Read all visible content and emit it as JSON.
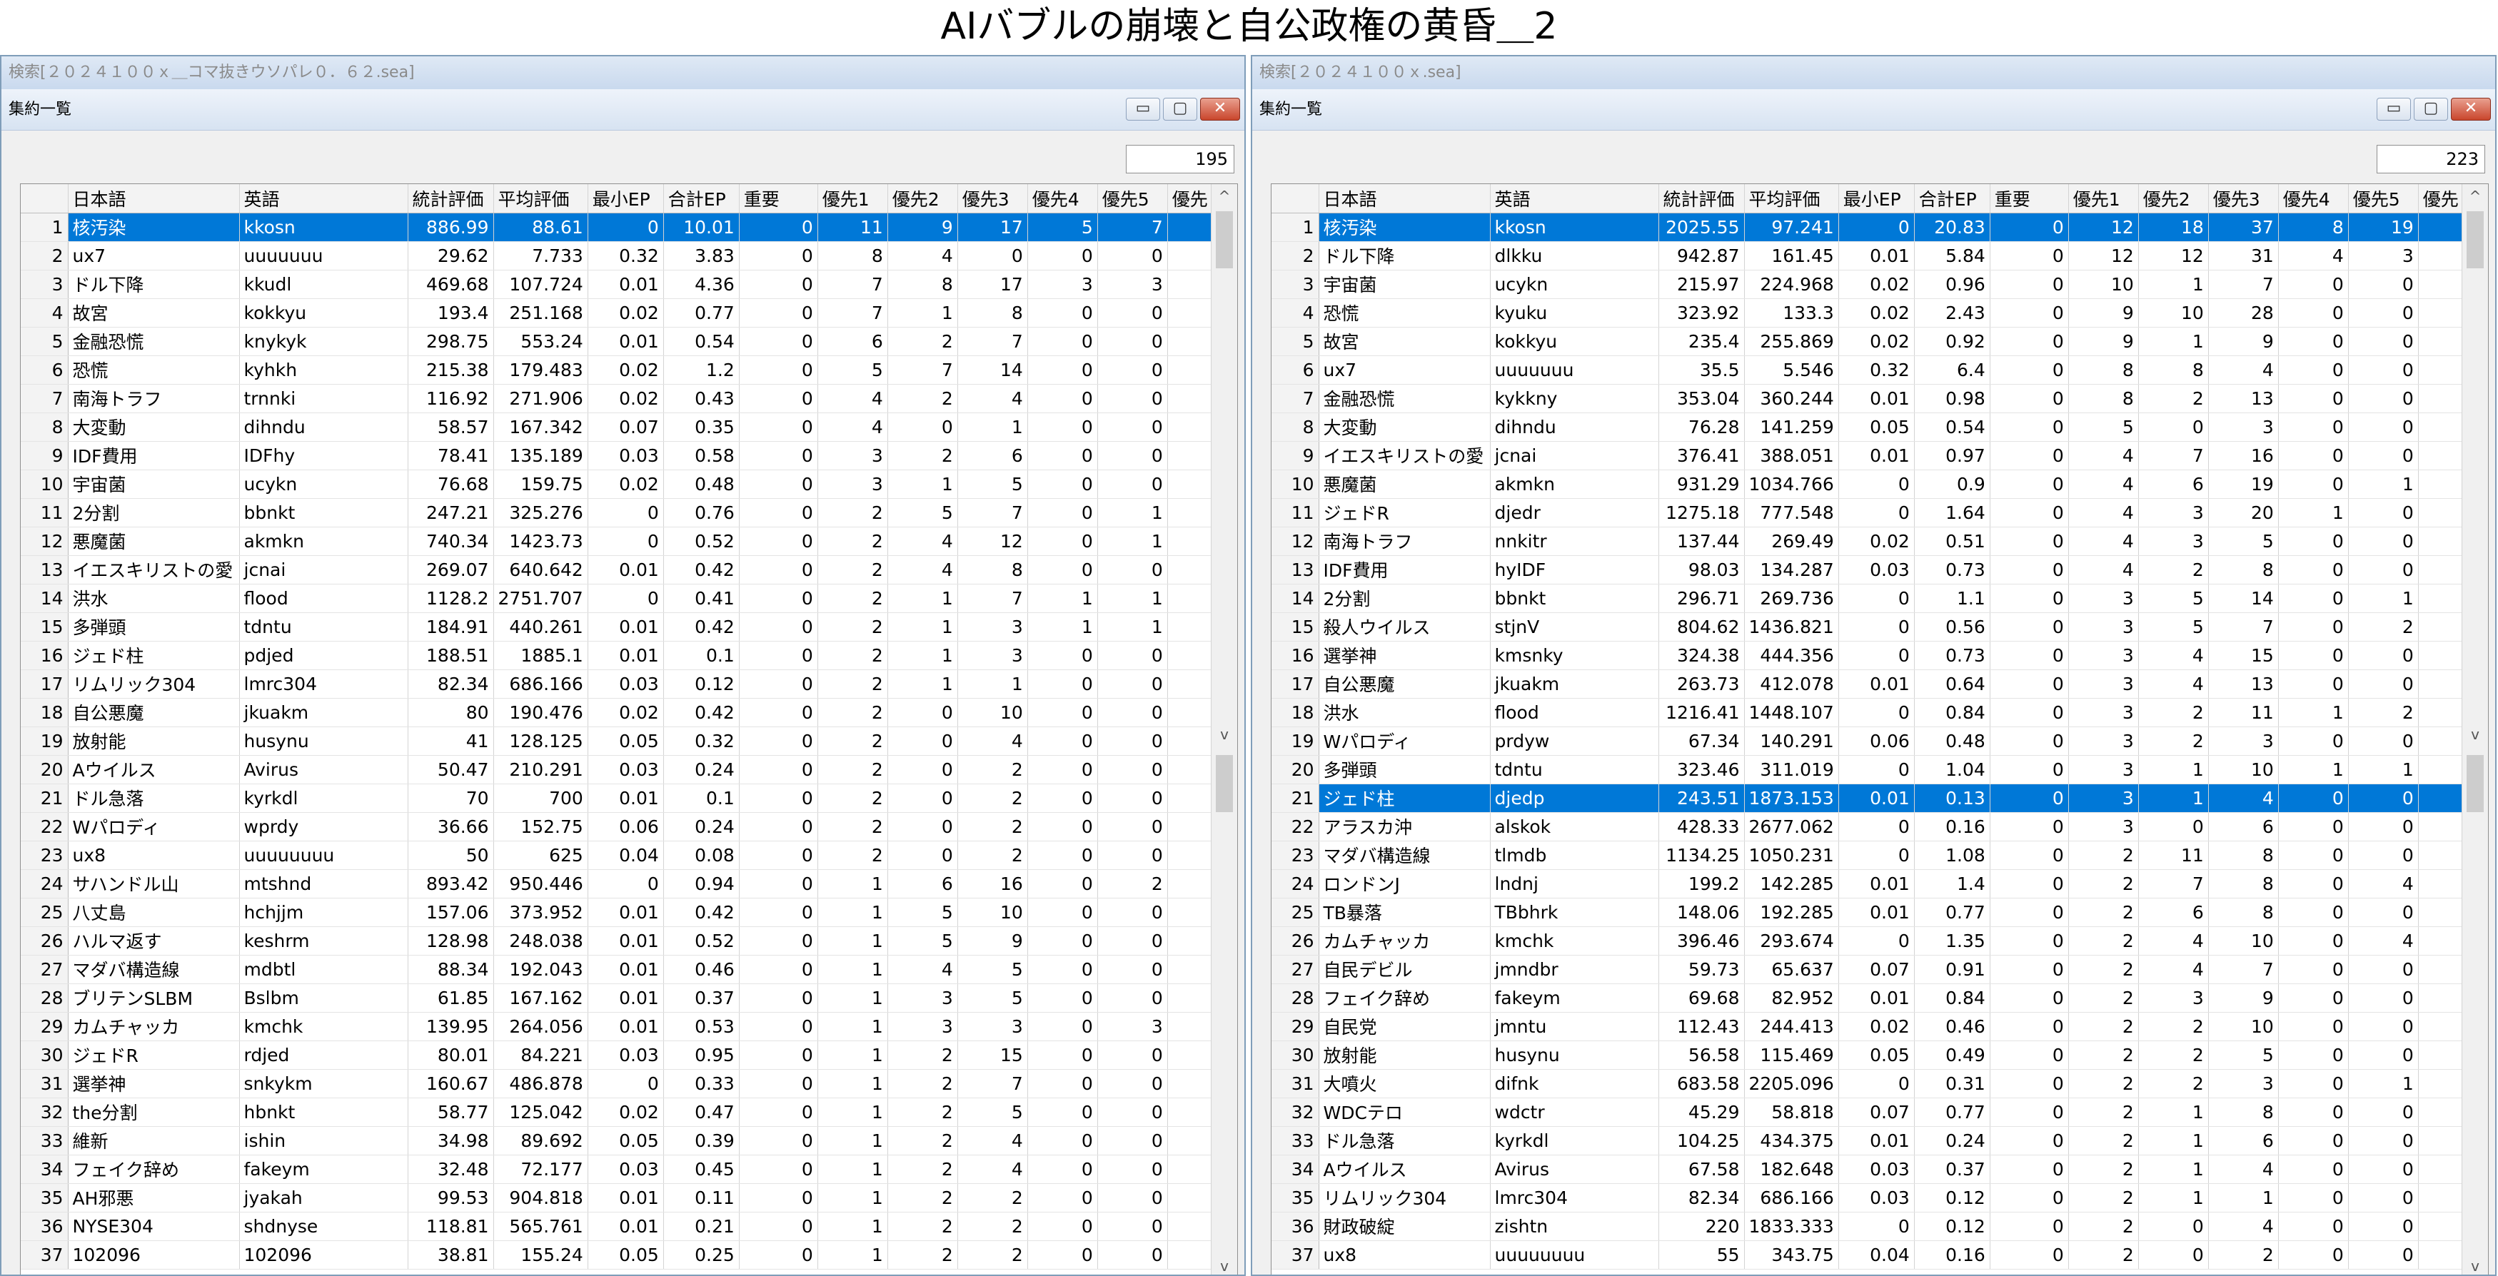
{
  "page_title": "AIバブルの崩壊と自公政権の黄昏＿2",
  "columns": [
    "日本語",
    "英語",
    "統計評価",
    "平均評価",
    "最小EP",
    "合計EP",
    "重要",
    "優先1",
    "優先2",
    "優先3",
    "優先4",
    "優先5",
    "優先"
  ],
  "icons": {
    "minimize": "minimize-icon",
    "maximize": "maximize-icon",
    "close": "close-icon",
    "scroll_up": "chevron-up-icon",
    "scroll_down": "chevron-down-icon"
  },
  "colors": {
    "selection": "#0078d7",
    "title_bar": "#c9d9ee",
    "close_button": "#c9452c"
  },
  "left": {
    "window_title": "検索[２０２４１００ｘ＿コマ抜きウソパレ０．６２.sea]",
    "panel_title": "集約一覧",
    "count": "195",
    "buttons": {
      "minimize": "▭",
      "maximize": "▢",
      "close": "✕"
    },
    "scroll_up": "^",
    "scroll_down": "v",
    "rows": [
      [
        "1",
        "核汚染",
        "kkosn",
        "886.99",
        "88.61",
        "0",
        "10.01",
        "0",
        "11",
        "9",
        "17",
        "5",
        "7"
      ],
      [
        "2",
        "ux7",
        "uuuuuuu",
        "29.62",
        "7.733",
        "0.32",
        "3.83",
        "0",
        "8",
        "4",
        "0",
        "0",
        "0"
      ],
      [
        "3",
        "ドル下降",
        "kkudl",
        "469.68",
        "107.724",
        "0.01",
        "4.36",
        "0",
        "7",
        "8",
        "17",
        "3",
        "3"
      ],
      [
        "4",
        "故宮",
        "kokkyu",
        "193.4",
        "251.168",
        "0.02",
        "0.77",
        "0",
        "7",
        "1",
        "8",
        "0",
        "0"
      ],
      [
        "5",
        "金融恐慌",
        "knykyk",
        "298.75",
        "553.24",
        "0.01",
        "0.54",
        "0",
        "6",
        "2",
        "7",
        "0",
        "0"
      ],
      [
        "6",
        "恐慌",
        "kyhkh",
        "215.38",
        "179.483",
        "0.02",
        "1.2",
        "0",
        "5",
        "7",
        "14",
        "0",
        "0"
      ],
      [
        "7",
        "南海トラフ",
        "trnnki",
        "116.92",
        "271.906",
        "0.02",
        "0.43",
        "0",
        "4",
        "2",
        "4",
        "0",
        "0"
      ],
      [
        "8",
        "大変動",
        "dihndu",
        "58.57",
        "167.342",
        "0.07",
        "0.35",
        "0",
        "4",
        "0",
        "1",
        "0",
        "0"
      ],
      [
        "9",
        "IDF費用",
        "IDFhy",
        "78.41",
        "135.189",
        "0.03",
        "0.58",
        "0",
        "3",
        "2",
        "6",
        "0",
        "0"
      ],
      [
        "10",
        "宇宙菌",
        "ucykn",
        "76.68",
        "159.75",
        "0.02",
        "0.48",
        "0",
        "3",
        "1",
        "5",
        "0",
        "0"
      ],
      [
        "11",
        "2分割",
        "bbnkt",
        "247.21",
        "325.276",
        "0",
        "0.76",
        "0",
        "2",
        "5",
        "7",
        "0",
        "1"
      ],
      [
        "12",
        "悪魔菌",
        "akmkn",
        "740.34",
        "1423.73",
        "0",
        "0.52",
        "0",
        "2",
        "4",
        "12",
        "0",
        "1"
      ],
      [
        "13",
        "イエスキリストの愛",
        "jcnai",
        "269.07",
        "640.642",
        "0.01",
        "0.42",
        "0",
        "2",
        "4",
        "8",
        "0",
        "0"
      ],
      [
        "14",
        "洪水",
        "flood",
        "1128.2",
        "2751.707",
        "0",
        "0.41",
        "0",
        "2",
        "1",
        "7",
        "1",
        "1"
      ],
      [
        "15",
        "多弾頭",
        "tdntu",
        "184.91",
        "440.261",
        "0.01",
        "0.42",
        "0",
        "2",
        "1",
        "3",
        "1",
        "1"
      ],
      [
        "16",
        "ジェド柱",
        "pdjed",
        "188.51",
        "1885.1",
        "0.01",
        "0.1",
        "0",
        "2",
        "1",
        "3",
        "0",
        "0"
      ],
      [
        "17",
        "リムリック304",
        "lmrc304",
        "82.34",
        "686.166",
        "0.03",
        "0.12",
        "0",
        "2",
        "1",
        "1",
        "0",
        "0"
      ],
      [
        "18",
        "自公悪魔",
        "jkuakm",
        "80",
        "190.476",
        "0.02",
        "0.42",
        "0",
        "2",
        "0",
        "10",
        "0",
        "0"
      ],
      [
        "19",
        "放射能",
        "husynu",
        "41",
        "128.125",
        "0.05",
        "0.32",
        "0",
        "2",
        "0",
        "4",
        "0",
        "0"
      ],
      [
        "20",
        "Aウイルス",
        "Avirus",
        "50.47",
        "210.291",
        "0.03",
        "0.24",
        "0",
        "2",
        "0",
        "2",
        "0",
        "0"
      ],
      [
        "21",
        "ドル急落",
        "kyrkdl",
        "70",
        "700",
        "0.01",
        "0.1",
        "0",
        "2",
        "0",
        "2",
        "0",
        "0"
      ],
      [
        "22",
        "Wパロディ",
        "wprdy",
        "36.66",
        "152.75",
        "0.06",
        "0.24",
        "0",
        "2",
        "0",
        "2",
        "0",
        "0"
      ],
      [
        "23",
        "ux8",
        "uuuuuuuu",
        "50",
        "625",
        "0.04",
        "0.08",
        "0",
        "2",
        "0",
        "2",
        "0",
        "0"
      ],
      [
        "24",
        "サハンドル山",
        "mtshnd",
        "893.42",
        "950.446",
        "0",
        "0.94",
        "0",
        "1",
        "6",
        "16",
        "0",
        "2"
      ],
      [
        "25",
        "八丈島",
        "hchjjm",
        "157.06",
        "373.952",
        "0.01",
        "0.42",
        "0",
        "1",
        "5",
        "10",
        "0",
        "0"
      ],
      [
        "26",
        "ハルマ返す",
        "keshrm",
        "128.98",
        "248.038",
        "0.01",
        "0.52",
        "0",
        "1",
        "5",
        "9",
        "0",
        "0"
      ],
      [
        "27",
        "マダバ構造線",
        "mdbtl",
        "88.34",
        "192.043",
        "0.01",
        "0.46",
        "0",
        "1",
        "4",
        "5",
        "0",
        "0"
      ],
      [
        "28",
        "ブリテンSLBM",
        "Bslbm",
        "61.85",
        "167.162",
        "0.01",
        "0.37",
        "0",
        "1",
        "3",
        "5",
        "0",
        "0"
      ],
      [
        "29",
        "カムチャッカ",
        "kmchk",
        "139.95",
        "264.056",
        "0.01",
        "0.53",
        "0",
        "1",
        "3",
        "3",
        "0",
        "3"
      ],
      [
        "30",
        "ジェドR",
        "rdjed",
        "80.01",
        "84.221",
        "0.03",
        "0.95",
        "0",
        "1",
        "2",
        "15",
        "0",
        "0"
      ],
      [
        "31",
        "選挙神",
        "snkykm",
        "160.67",
        "486.878",
        "0",
        "0.33",
        "0",
        "1",
        "2",
        "7",
        "0",
        "0"
      ],
      [
        "32",
        "the分割",
        "hbnkt",
        "58.77",
        "125.042",
        "0.02",
        "0.47",
        "0",
        "1",
        "2",
        "5",
        "0",
        "0"
      ],
      [
        "33",
        "維新",
        "ishin",
        "34.98",
        "89.692",
        "0.05",
        "0.39",
        "0",
        "1",
        "2",
        "4",
        "0",
        "0"
      ],
      [
        "34",
        "フェイク辞め",
        "fakeym",
        "32.48",
        "72.177",
        "0.03",
        "0.45",
        "0",
        "1",
        "2",
        "4",
        "0",
        "0"
      ],
      [
        "35",
        "AH邪悪",
        "jyakah",
        "99.53",
        "904.818",
        "0.01",
        "0.11",
        "0",
        "1",
        "2",
        "2",
        "0",
        "0"
      ],
      [
        "36",
        "NYSE304",
        "shdnyse",
        "118.81",
        "565.761",
        "0.01",
        "0.21",
        "0",
        "1",
        "2",
        "2",
        "0",
        "0"
      ],
      [
        "37",
        "102096",
        "102096",
        "38.81",
        "155.24",
        "0.05",
        "0.25",
        "0",
        "1",
        "2",
        "2",
        "0",
        "0"
      ]
    ]
  },
  "right": {
    "window_title": "検索[２０２４１００ｘ.sea]",
    "panel_title": "集約一覧",
    "count": "223",
    "buttons": {
      "minimize": "▭",
      "maximize": "▢",
      "close": "✕"
    },
    "scroll_up": "^",
    "scroll_down": "v",
    "rows": [
      [
        "1",
        "核汚染",
        "kkosn",
        "2025.55",
        "97.241",
        "0",
        "20.83",
        "0",
        "12",
        "18",
        "37",
        "8",
        "19"
      ],
      [
        "2",
        "ドル下降",
        "dlkku",
        "942.87",
        "161.45",
        "0.01",
        "5.84",
        "0",
        "12",
        "12",
        "31",
        "4",
        "3"
      ],
      [
        "3",
        "宇宙菌",
        "ucykn",
        "215.97",
        "224.968",
        "0.02",
        "0.96",
        "0",
        "10",
        "1",
        "7",
        "0",
        "0"
      ],
      [
        "4",
        "恐慌",
        "kyuku",
        "323.92",
        "133.3",
        "0.02",
        "2.43",
        "0",
        "9",
        "10",
        "28",
        "0",
        "0"
      ],
      [
        "5",
        "故宮",
        "kokkyu",
        "235.4",
        "255.869",
        "0.02",
        "0.92",
        "0",
        "9",
        "1",
        "9",
        "0",
        "0"
      ],
      [
        "6",
        "ux7",
        "uuuuuuu",
        "35.5",
        "5.546",
        "0.32",
        "6.4",
        "0",
        "8",
        "8",
        "4",
        "0",
        "0"
      ],
      [
        "7",
        "金融恐慌",
        "kykkny",
        "353.04",
        "360.244",
        "0.01",
        "0.98",
        "0",
        "8",
        "2",
        "13",
        "0",
        "0"
      ],
      [
        "8",
        "大変動",
        "dihndu",
        "76.28",
        "141.259",
        "0.05",
        "0.54",
        "0",
        "5",
        "0",
        "3",
        "0",
        "0"
      ],
      [
        "9",
        "イエスキリストの愛",
        "jcnai",
        "376.41",
        "388.051",
        "0.01",
        "0.97",
        "0",
        "4",
        "7",
        "16",
        "0",
        "0"
      ],
      [
        "10",
        "悪魔菌",
        "akmkn",
        "931.29",
        "1034.766",
        "0",
        "0.9",
        "0",
        "4",
        "6",
        "19",
        "0",
        "1"
      ],
      [
        "11",
        "ジェドR",
        "djedr",
        "1275.18",
        "777.548",
        "0",
        "1.64",
        "0",
        "4",
        "3",
        "20",
        "1",
        "0"
      ],
      [
        "12",
        "南海トラフ",
        "nnkitr",
        "137.44",
        "269.49",
        "0.02",
        "0.51",
        "0",
        "4",
        "3",
        "5",
        "0",
        "0"
      ],
      [
        "13",
        "IDF費用",
        "hyIDF",
        "98.03",
        "134.287",
        "0.03",
        "0.73",
        "0",
        "4",
        "2",
        "8",
        "0",
        "0"
      ],
      [
        "14",
        "2分割",
        "bbnkt",
        "296.71",
        "269.736",
        "0",
        "1.1",
        "0",
        "3",
        "5",
        "14",
        "0",
        "1"
      ],
      [
        "15",
        "殺人ウイルス",
        "stjnV",
        "804.62",
        "1436.821",
        "0",
        "0.56",
        "0",
        "3",
        "5",
        "7",
        "0",
        "2"
      ],
      [
        "16",
        "選挙神",
        "kmsnky",
        "324.38",
        "444.356",
        "0",
        "0.73",
        "0",
        "3",
        "4",
        "15",
        "0",
        "0"
      ],
      [
        "17",
        "自公悪魔",
        "jkuakm",
        "263.73",
        "412.078",
        "0.01",
        "0.64",
        "0",
        "3",
        "4",
        "13",
        "0",
        "0"
      ],
      [
        "18",
        "洪水",
        "flood",
        "1216.41",
        "1448.107",
        "0",
        "0.84",
        "0",
        "3",
        "2",
        "11",
        "1",
        "2"
      ],
      [
        "19",
        "Wパロディ",
        "prdyw",
        "67.34",
        "140.291",
        "0.06",
        "0.48",
        "0",
        "3",
        "2",
        "3",
        "0",
        "0"
      ],
      [
        "20",
        "多弾頭",
        "tdntu",
        "323.46",
        "311.019",
        "0",
        "1.04",
        "0",
        "3",
        "1",
        "10",
        "1",
        "1"
      ],
      [
        "21",
        "ジェド柱",
        "djedp",
        "243.51",
        "1873.153",
        "0.01",
        "0.13",
        "0",
        "3",
        "1",
        "4",
        "0",
        "0"
      ],
      [
        "22",
        "アラスカ沖",
        "alskok",
        "428.33",
        "2677.062",
        "0",
        "0.16",
        "0",
        "3",
        "0",
        "6",
        "0",
        "0"
      ],
      [
        "23",
        "マダバ構造線",
        "tlmdb",
        "1134.25",
        "1050.231",
        "0",
        "1.08",
        "0",
        "2",
        "11",
        "8",
        "0",
        "0"
      ],
      [
        "24",
        "ロンドンJ",
        "lndnj",
        "199.2",
        "142.285",
        "0.01",
        "1.4",
        "0",
        "2",
        "7",
        "8",
        "0",
        "4"
      ],
      [
        "25",
        "TB暴落",
        "TBbhrk",
        "148.06",
        "192.285",
        "0.01",
        "0.77",
        "0",
        "2",
        "6",
        "8",
        "0",
        "0"
      ],
      [
        "26",
        "カムチャッカ",
        "kmchk",
        "396.46",
        "293.674",
        "0",
        "1.35",
        "0",
        "2",
        "4",
        "10",
        "0",
        "4"
      ],
      [
        "27",
        "自民デビル",
        "jmndbr",
        "59.73",
        "65.637",
        "0.07",
        "0.91",
        "0",
        "2",
        "4",
        "7",
        "0",
        "0"
      ],
      [
        "28",
        "フェイク辞め",
        "fakeym",
        "69.68",
        "82.952",
        "0.01",
        "0.84",
        "0",
        "2",
        "3",
        "9",
        "0",
        "0"
      ],
      [
        "29",
        "自民党",
        "jmntu",
        "112.43",
        "244.413",
        "0.02",
        "0.46",
        "0",
        "2",
        "2",
        "10",
        "0",
        "0"
      ],
      [
        "30",
        "放射能",
        "husynu",
        "56.58",
        "115.469",
        "0.05",
        "0.49",
        "0",
        "2",
        "2",
        "5",
        "0",
        "0"
      ],
      [
        "31",
        "大噴火",
        "difnk",
        "683.58",
        "2205.096",
        "0",
        "0.31",
        "0",
        "2",
        "2",
        "3",
        "0",
        "1"
      ],
      [
        "32",
        "WDCテロ",
        "wdctr",
        "45.29",
        "58.818",
        "0.07",
        "0.77",
        "0",
        "2",
        "1",
        "8",
        "0",
        "0"
      ],
      [
        "33",
        "ドル急落",
        "kyrkdl",
        "104.25",
        "434.375",
        "0.01",
        "0.24",
        "0",
        "2",
        "1",
        "6",
        "0",
        "0"
      ],
      [
        "34",
        "Aウイルス",
        "Avirus",
        "67.58",
        "182.648",
        "0.03",
        "0.37",
        "0",
        "2",
        "1",
        "4",
        "0",
        "0"
      ],
      [
        "35",
        "リムリック304",
        "lmrc304",
        "82.34",
        "686.166",
        "0.03",
        "0.12",
        "0",
        "2",
        "1",
        "1",
        "0",
        "0"
      ],
      [
        "36",
        "財政破綻",
        "zishtn",
        "220",
        "1833.333",
        "0",
        "0.12",
        "0",
        "2",
        "0",
        "4",
        "0",
        "0"
      ],
      [
        "37",
        "ux8",
        "uuuuuuuu",
        "55",
        "343.75",
        "0.04",
        "0.16",
        "0",
        "2",
        "0",
        "2",
        "0",
        "0"
      ]
    ]
  }
}
